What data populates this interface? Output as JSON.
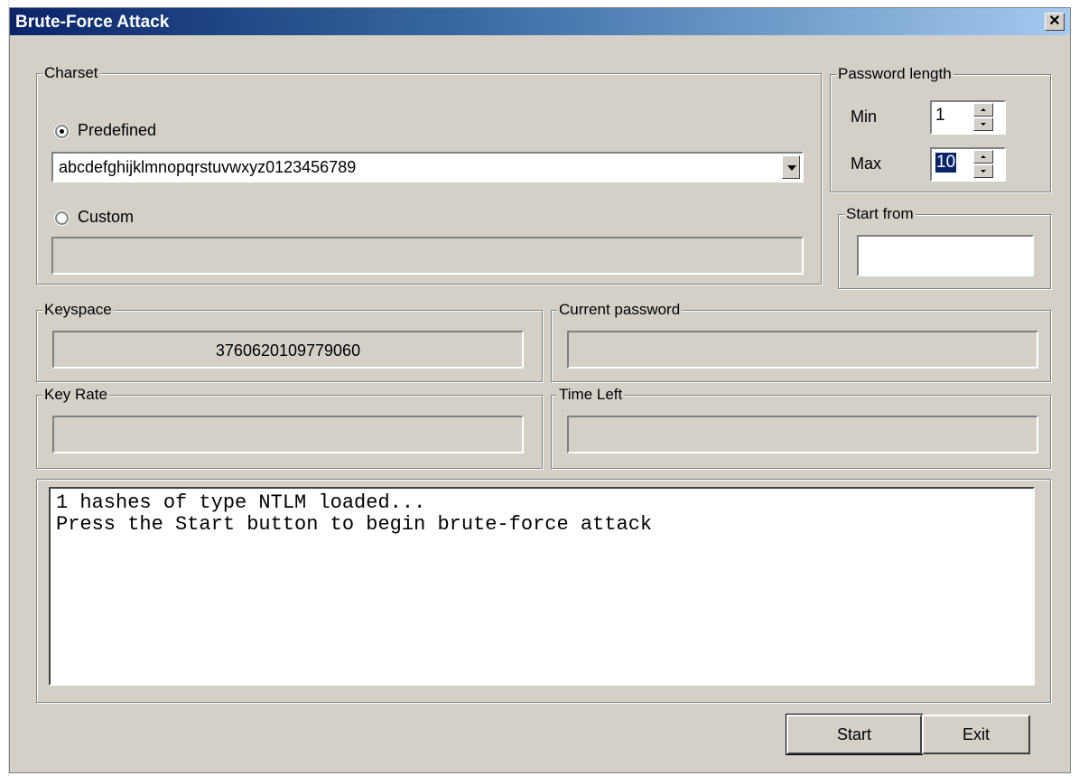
{
  "window": {
    "title": "Brute-Force Attack",
    "close_glyph": "✕"
  },
  "charset": {
    "legend": "Charset",
    "predefined_label": "Predefined",
    "predefined_selected": true,
    "predefined_value": "abcdefghijklmnopqrstuvwxyz0123456789",
    "custom_label": "Custom",
    "custom_selected": false,
    "custom_value": ""
  },
  "password_length": {
    "legend": "Password length",
    "min_label": "Min",
    "min_value": "1",
    "max_label": "Max",
    "max_value": "10"
  },
  "start_from": {
    "legend": "Start from",
    "value": ""
  },
  "keyspace": {
    "legend": "Keyspace",
    "value": "3760620109779060"
  },
  "current_password": {
    "legend": "Current password",
    "value": ""
  },
  "key_rate": {
    "legend": "Key Rate",
    "value": ""
  },
  "time_left": {
    "legend": "Time Left",
    "value": ""
  },
  "log": {
    "lines": [
      "1 hashes of type NTLM loaded...",
      "Press the Start button to begin brute-force attack"
    ]
  },
  "buttons": {
    "start": "Start",
    "exit": "Exit"
  },
  "icons": {
    "close": "close-icon",
    "dropdown": "chevron-down-icon",
    "spin_up": "arrow-up-icon",
    "spin_down": "arrow-down-icon"
  },
  "colors": {
    "face": "#d4d0c8",
    "title_start": "#0a246a",
    "title_end": "#a6caf0",
    "selection": "#0a246a"
  }
}
